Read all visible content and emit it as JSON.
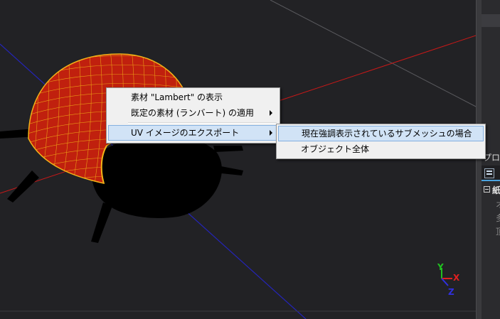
{
  "context_menu": {
    "items": [
      {
        "label": "素材 \"Lambert\" の表示",
        "has_submenu": false,
        "highlighted": false
      },
      {
        "label": "既定の素材 (ランバート) の適用",
        "has_submenu": true,
        "highlighted": false
      },
      {
        "label": "UV イメージのエクスポート",
        "has_submenu": true,
        "highlighted": true
      }
    ]
  },
  "submenu": {
    "items": [
      {
        "label": "現在強調表示されているサブメッシュの場合",
        "highlighted": true
      },
      {
        "label": "オブジェクト全体",
        "highlighted": false
      }
    ]
  },
  "right_panel": {
    "header": "プロパ",
    "group_label": "紙",
    "lines": [
      "オ",
      "多",
      "頂"
    ]
  },
  "axis_gizmo": {
    "y": "Y",
    "x": "X",
    "z": "Z"
  },
  "colors": {
    "viewport_bg": "#222225",
    "mesh_fill": "#c0200e",
    "mesh_wire": "#f2b318",
    "axis_red": "#d01818",
    "axis_blue": "#2222c0",
    "menu_bg": "#f0f0f0",
    "menu_highlight": "#d1e3f6"
  }
}
